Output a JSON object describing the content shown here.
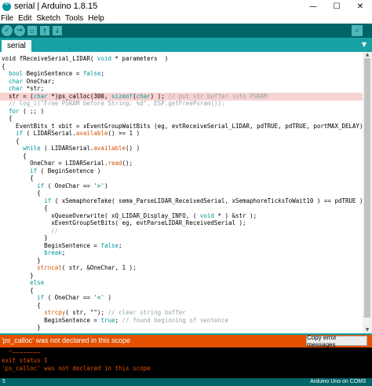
{
  "window": {
    "title": "serial | Arduino 1.8.15",
    "minimize_glyph": "—",
    "maximize_glyph": "☐",
    "close_glyph": "✕"
  },
  "menu": {
    "items": [
      "File",
      "Edit",
      "Sketch",
      "Tools",
      "Help"
    ]
  },
  "toolbar": {
    "verify_glyph": "✓",
    "upload_glyph": "→",
    "new_glyph": "▫",
    "open_glyph": "↑",
    "save_glyph": "↓",
    "serial_glyph": "⌕"
  },
  "tabs": {
    "active": "serial",
    "menu_glyph": "▼"
  },
  "editor": {
    "highlighted_line": 5,
    "lines": [
      [
        [
          "t",
          "void fReceiveSerial_LIDAR( "
        ],
        [
          "kw",
          "void"
        ],
        [
          "t",
          " * parameters  )"
        ]
      ],
      [
        [
          "t",
          "{"
        ]
      ],
      [
        [
          "t",
          "  "
        ],
        [
          "kw",
          "bool"
        ],
        [
          "t",
          " BeginSentence = "
        ],
        [
          "kw",
          "false"
        ],
        [
          "t",
          ";"
        ]
      ],
      [
        [
          "t",
          "  "
        ],
        [
          "kw",
          "char"
        ],
        [
          "t",
          " OneChar;"
        ]
      ],
      [
        [
          "t",
          "  "
        ],
        [
          "kw",
          "char"
        ],
        [
          "t",
          " *str;"
        ]
      ],
      [
        [
          "t",
          "  str = ("
        ],
        [
          "kw",
          "char"
        ],
        [
          "t",
          " *)ps_calloc(300, "
        ],
        [
          "kw",
          "sizeof"
        ],
        [
          "t",
          "("
        ],
        [
          "kw",
          "char"
        ],
        [
          "t",
          ") ); "
        ],
        [
          "cm",
          "// put str buffer into PSRAM"
        ]
      ],
      [
        [
          "cm",
          "  // log_i(\"Free PSRAM before String: %d\", ESP.getFreePsram());"
        ]
      ],
      [
        [
          "t",
          "  "
        ],
        [
          "kw",
          "for"
        ],
        [
          "t",
          " ( ;; )"
        ]
      ],
      [
        [
          "t",
          "  {"
        ]
      ],
      [
        [
          "t",
          "    EventBits_t xbit = xEventGroupWaitBits (eg, evtReceiveSerial_LIDAR, pdTRUE, pdTRUE, portMAX_DELAY);"
        ]
      ],
      [
        [
          "t",
          "    "
        ],
        [
          "kw",
          "if"
        ],
        [
          "t",
          " ( LIDARSerial."
        ],
        [
          "fn",
          "available"
        ],
        [
          "t",
          "() >= 1 )"
        ]
      ],
      [
        [
          "t",
          "    {"
        ]
      ],
      [
        [
          "t",
          "      "
        ],
        [
          "kw",
          "while"
        ],
        [
          "t",
          " ( LIDARSerial."
        ],
        [
          "fn",
          "available"
        ],
        [
          "t",
          "() )"
        ]
      ],
      [
        [
          "t",
          "      {"
        ]
      ],
      [
        [
          "t",
          "        OneChar = LIDARSerial."
        ],
        [
          "fn",
          "read"
        ],
        [
          "t",
          "();"
        ]
      ],
      [
        [
          "t",
          "        "
        ],
        [
          "kw",
          "if"
        ],
        [
          "t",
          " ( BeginSentence )"
        ]
      ],
      [
        [
          "t",
          "        {"
        ]
      ],
      [
        [
          "t",
          "          "
        ],
        [
          "kw",
          "if"
        ],
        [
          "t",
          " ( OneChar == "
        ],
        [
          "st",
          "'>'"
        ],
        [
          "t",
          ")"
        ]
      ],
      [
        [
          "t",
          "          {"
        ]
      ],
      [
        [
          "t",
          "            "
        ],
        [
          "kw",
          "if"
        ],
        [
          "t",
          " ( xSemaphoreTake( sema_ParseLIDAR_ReceivedSerial, xSemaphoreTicksToWait10 ) == pdTRUE )"
        ]
      ],
      [
        [
          "t",
          "            {"
        ]
      ],
      [
        [
          "t",
          "              xQueueOverwrite( xQ_LIDAR_Display_INFO, ( "
        ],
        [
          "kw",
          "void"
        ],
        [
          "t",
          " * ) &str );"
        ]
      ],
      [
        [
          "t",
          "              xEventGroupSetBits( eg, evtParseLIDAR_ReceivedSerial );"
        ]
      ],
      [
        [
          "cm",
          "              //"
        ]
      ],
      [
        [
          "t",
          "            }"
        ]
      ],
      [
        [
          "t",
          "            BeginSentence = "
        ],
        [
          "kw",
          "false"
        ],
        [
          "t",
          ";"
        ]
      ],
      [
        [
          "t",
          "            "
        ],
        [
          "kw",
          "break"
        ],
        [
          "t",
          ";"
        ]
      ],
      [
        [
          "t",
          "          }"
        ]
      ],
      [
        [
          "t",
          "          "
        ],
        [
          "fn",
          "strncat"
        ],
        [
          "t",
          "( str, &OneChar, 1 );"
        ]
      ],
      [
        [
          "t",
          "        }"
        ]
      ],
      [
        [
          "t",
          "        "
        ],
        [
          "kw",
          "else"
        ]
      ],
      [
        [
          "t",
          "        {"
        ]
      ],
      [
        [
          "t",
          "          "
        ],
        [
          "kw",
          "if"
        ],
        [
          "t",
          " ( OneChar == "
        ],
        [
          "st",
          "'<'"
        ],
        [
          "t",
          " )"
        ]
      ],
      [
        [
          "t",
          "          {"
        ]
      ],
      [
        [
          "t",
          "            "
        ],
        [
          "fn",
          "strcpy"
        ],
        [
          "t",
          "( str, \"\"); "
        ],
        [
          "cm",
          "// clear string buffer"
        ]
      ],
      [
        [
          "t",
          "            BeginSentence = "
        ],
        [
          "kw",
          "true"
        ],
        [
          "t",
          "; "
        ],
        [
          "cm",
          "// found beginning of sentence"
        ]
      ],
      [
        [
          "t",
          "          }"
        ]
      ]
    ]
  },
  "status": {
    "error_message": "'ps_calloc' was not declared in this scope",
    "copy_button": "Copy error messages"
  },
  "console": {
    "lines": [
      "  ^~~~~~~~~",
      "exit status 1",
      "'ps_calloc' was not declared in this scope"
    ]
  },
  "footer": {
    "line_number": "5",
    "board": "Arduino Uno on COM3"
  },
  "colors": {
    "toolbar": "#006468",
    "tabs": "#17a1a5",
    "button": "#4db7bb",
    "error": "#e35000",
    "highlight": "#f9d3d3",
    "keyword": "#00979c",
    "function": "#d35400",
    "comment": "#95a5a6"
  }
}
